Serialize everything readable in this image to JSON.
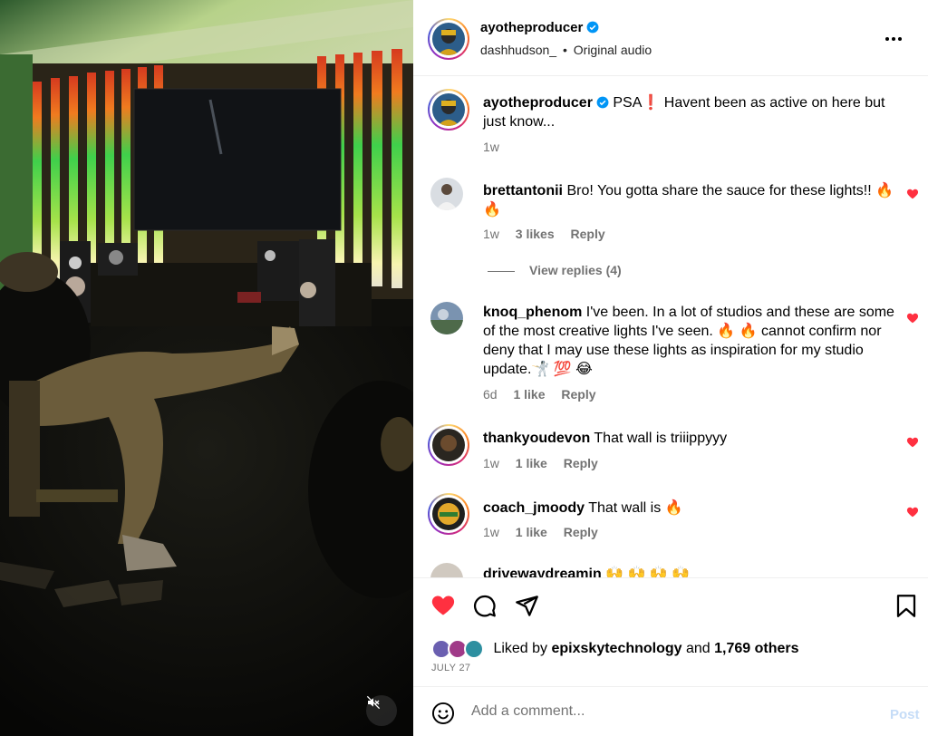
{
  "post": {
    "author": "ayotheproducer",
    "audio_user": "dashhudson_",
    "audio_sep": "•",
    "audio_label": "Original audio"
  },
  "caption": {
    "username": "ayotheproducer",
    "text": "PSA❗ Havent been as active on here but just know...",
    "time": "1w"
  },
  "comments": [
    {
      "username": "brettantonii",
      "text": "Bro! You gotta share the sauce for these lights!! 🔥 🔥",
      "time": "1w",
      "likes": "3 likes",
      "reply": "Reply"
    },
    {
      "username": "knoq_phenom",
      "text": "I've been. In a lot of studios and these are some of the most creative lights I've seen. 🔥 🔥 cannot confirm nor deny that I may use these lights as inspiration for my studio update.🤺 💯 😂",
      "time": "6d",
      "likes": "1 like",
      "reply": "Reply"
    },
    {
      "username": "thankyoudevon",
      "text": "That wall is triiippyyy",
      "time": "1w",
      "likes": "1 like",
      "reply": "Reply"
    },
    {
      "username": "coach_jmoody",
      "text": "That wall is 🔥",
      "time": "1w",
      "likes": "1 like",
      "reply": "Reply"
    },
    {
      "username": "drivewaydreamin",
      "text": "🙌 🙌 🙌 🙌"
    }
  ],
  "view_replies": "View replies (4)",
  "likes": {
    "prefix": "Liked by",
    "user": "epixskytechnology",
    "connector": "and",
    "others": "1,769 others"
  },
  "date": "JULY 27",
  "composer": {
    "placeholder": "Add a comment...",
    "post_label": "Post"
  },
  "icons": {
    "verified": "verified-badge-icon",
    "more": "more-options-icon",
    "like": "heart-icon",
    "comment": "comment-icon",
    "share": "share-icon",
    "save": "bookmark-icon",
    "emoji": "emoji-icon",
    "mute": "muted-speaker-icon"
  },
  "colors": {
    "heart_liked": "#ff3040",
    "verified": "#0095f6",
    "post_disabled": "#c5dcf7"
  }
}
